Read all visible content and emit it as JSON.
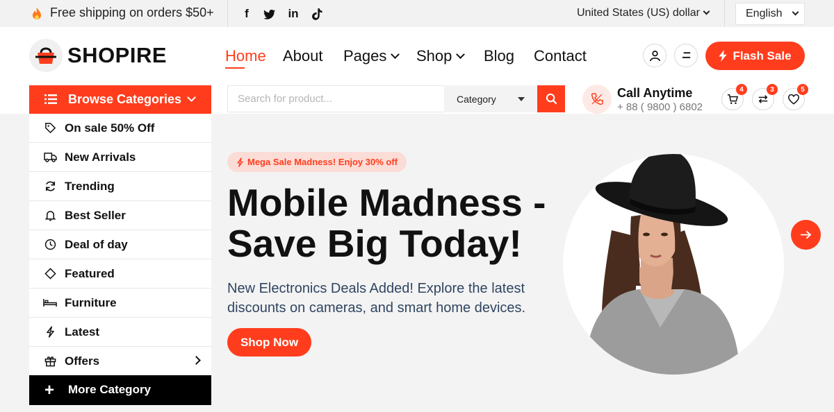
{
  "topbar": {
    "shipping_text": "Free shipping on orders $50+",
    "social": [
      {
        "icon": "facebook-icon",
        "glyph": "f"
      },
      {
        "icon": "twitter-icon",
        "glyph": "t"
      },
      {
        "icon": "linkedin-icon",
        "glyph": "in"
      },
      {
        "icon": "tiktok-icon",
        "glyph": "d"
      }
    ],
    "currency": "United States (US) dollar",
    "language": "English"
  },
  "header": {
    "logo_text": "SHOPIRE",
    "nav": [
      {
        "label": "Home",
        "active": true
      },
      {
        "label": "About"
      },
      {
        "label": "Pages",
        "dropdown": true
      },
      {
        "label": "Shop",
        "dropdown": true
      },
      {
        "label": "Blog"
      },
      {
        "label": "Contact"
      }
    ],
    "flash_sale_label": "Flash Sale"
  },
  "search_row": {
    "browse_label": "Browse Categories",
    "search_placeholder": "Search for product...",
    "category_label": "Category",
    "call_title": "Call Anytime",
    "call_phone": "+ 88 ( 9800 ) 6802",
    "cart_count": "4",
    "compare_count": "3",
    "wishlist_count": "5"
  },
  "sidebar": {
    "items": [
      {
        "label": "On sale 50% Off",
        "icon": "tag-icon"
      },
      {
        "label": "New Arrivals",
        "icon": "truck-icon"
      },
      {
        "label": "Trending",
        "icon": "refresh-icon"
      },
      {
        "label": "Best Seller",
        "icon": "bell-icon"
      },
      {
        "label": "Deal of day",
        "icon": "clock-icon"
      },
      {
        "label": "Featured",
        "icon": "diamond-icon"
      },
      {
        "label": "Furniture",
        "icon": "bed-icon"
      },
      {
        "label": "Latest",
        "icon": "bolt-icon"
      },
      {
        "label": "Offers",
        "icon": "gift-icon"
      }
    ],
    "more_label": "More Category"
  },
  "hero": {
    "promo_text": "Mega Sale Madness! Enjoy 30% off",
    "headline_line1": "Mobile Madness -",
    "headline_line2": "Save Big Today!",
    "subtext": "New Electronics Deals Added! Explore the latest discounts on cameras, and smart home devices.",
    "cta_label": "Shop Now"
  },
  "colors": {
    "accent": "#ff3d1d",
    "hero_background": "#f3f3f3",
    "subtext": "#2f4561"
  }
}
